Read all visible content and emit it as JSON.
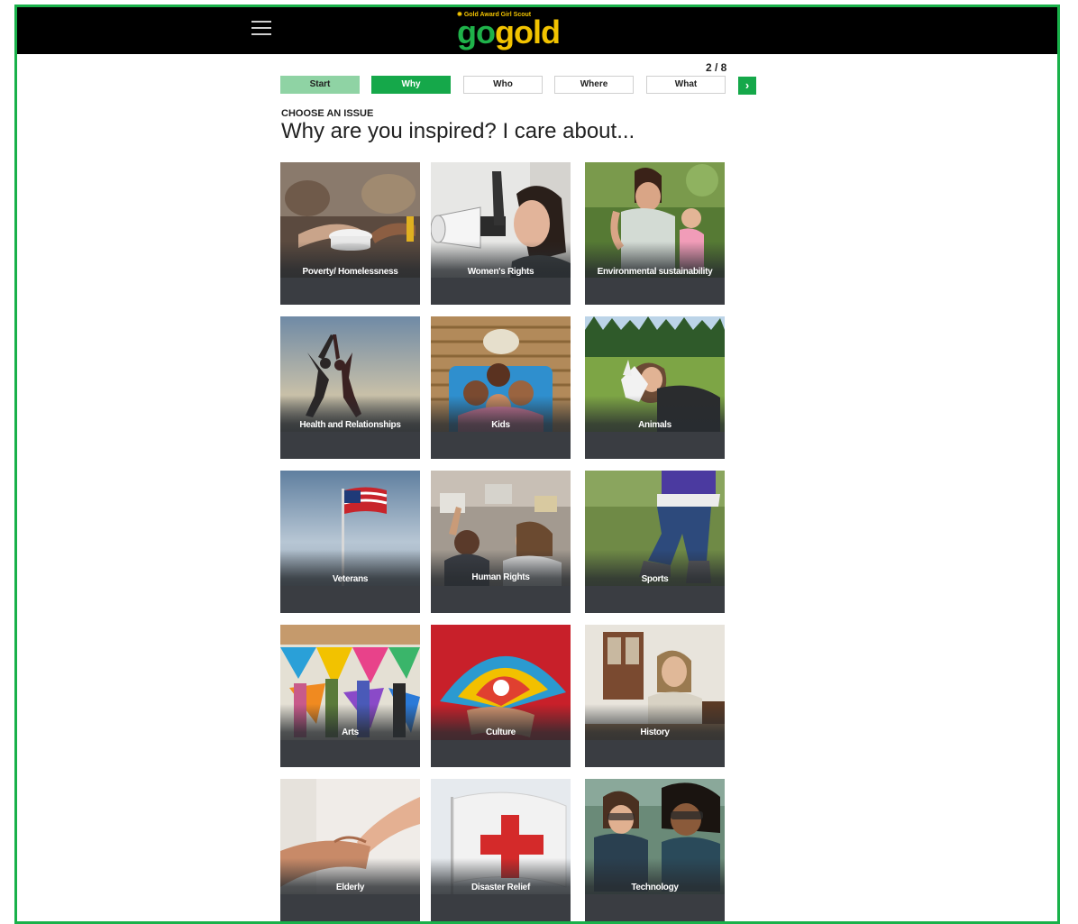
{
  "header": {
    "menu_icon": "hamburger-menu-icon",
    "logo_tagline": "Gold Award Girl Scout",
    "logo_go": "go",
    "logo_gold": "gold"
  },
  "progress": {
    "count": "2 / 8",
    "steps": [
      {
        "label": "Start",
        "state": "done"
      },
      {
        "label": "Why",
        "state": "active"
      },
      {
        "label": "Who",
        "state": "pending"
      },
      {
        "label": "Where",
        "state": "pending"
      },
      {
        "label": "What",
        "state": "pending"
      }
    ],
    "next_label": "›",
    "next_icon": "chevron-right-icon"
  },
  "intro": {
    "eyebrow": "CHOOSE AN ISSUE",
    "heading": "Why are you inspired? I care about..."
  },
  "issues": [
    {
      "label": "Poverty/ Homelessness"
    },
    {
      "label": "Women's Rights"
    },
    {
      "label": "Environmental sustainability"
    },
    {
      "label": "Health and Relationships"
    },
    {
      "label": "Kids"
    },
    {
      "label": "Animals"
    },
    {
      "label": "Veterans"
    },
    {
      "label": "Human Rights"
    },
    {
      "label": "Sports"
    },
    {
      "label": "Arts"
    },
    {
      "label": "Culture"
    },
    {
      "label": "History"
    },
    {
      "label": "Elderly"
    },
    {
      "label": "Disaster Relief"
    },
    {
      "label": "Technology"
    }
  ],
  "colors": {
    "brand_green": "#15a84a",
    "step_done": "#8fd3a4",
    "logo_gold": "#f2c300",
    "frame_border": "#19b14a"
  }
}
